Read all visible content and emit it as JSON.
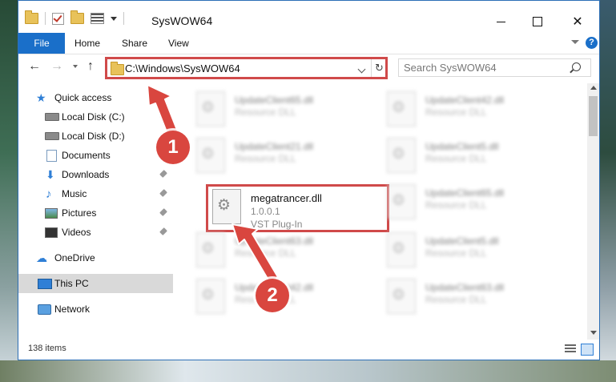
{
  "window": {
    "title": "SysWOW64"
  },
  "ribbon": {
    "tabs": [
      "File",
      "Home",
      "Share",
      "View"
    ],
    "help": "?"
  },
  "nav": {
    "back": "←",
    "forward": "→",
    "up": "↑",
    "address": "C:\\Windows\\SysWOW64",
    "refresh": "↻",
    "search_placeholder": "Search SysWOW64"
  },
  "sidebar": {
    "items": [
      {
        "label": "Quick access",
        "icon": "star-icon"
      },
      {
        "label": "Local Disk (C:)",
        "icon": "drive-icon"
      },
      {
        "label": "Local Disk (D:)",
        "icon": "drive-icon"
      },
      {
        "label": "Documents",
        "icon": "document-icon"
      },
      {
        "label": "Downloads",
        "icon": "download-icon"
      },
      {
        "label": "Music",
        "icon": "music-icon"
      },
      {
        "label": "Pictures",
        "icon": "pictures-icon"
      },
      {
        "label": "Videos",
        "icon": "videos-icon"
      },
      {
        "label": "OneDrive",
        "icon": "cloud-icon"
      },
      {
        "label": "This PC",
        "icon": "computer-icon"
      },
      {
        "label": "Network",
        "icon": "network-icon"
      }
    ]
  },
  "files": {
    "blurred": [
      {
        "name": "UpdateClient65.dll",
        "type": "Resource DLL"
      },
      {
        "name": "UpdateClient42.dll",
        "type": "Resource DLL"
      },
      {
        "name": "UpdateClient21.dll",
        "type": "Resource DLL"
      },
      {
        "name": "UpdateClient5.dll",
        "type": "Resource DLL"
      },
      {
        "name": "UpdateClient65.dll",
        "type": "Resource DLL"
      },
      {
        "name": "UpdateClient63.dll",
        "type": "Resource DLL"
      },
      {
        "name": "UpdateClient5.dll",
        "type": "Resource DLL"
      },
      {
        "name": "UpdateClient42.dll",
        "type": "Resource DLL"
      },
      {
        "name": "UpdateClient63.dll",
        "type": "Resource DLL"
      }
    ],
    "highlighted": {
      "name": "megatrancer.dll",
      "version": "1.0.0.1",
      "type": "VST Plug-In"
    }
  },
  "status": {
    "item_count": "138 items"
  },
  "annotations": {
    "step1": "1",
    "step2": "2",
    "highlight_color": "#d04a4a"
  }
}
